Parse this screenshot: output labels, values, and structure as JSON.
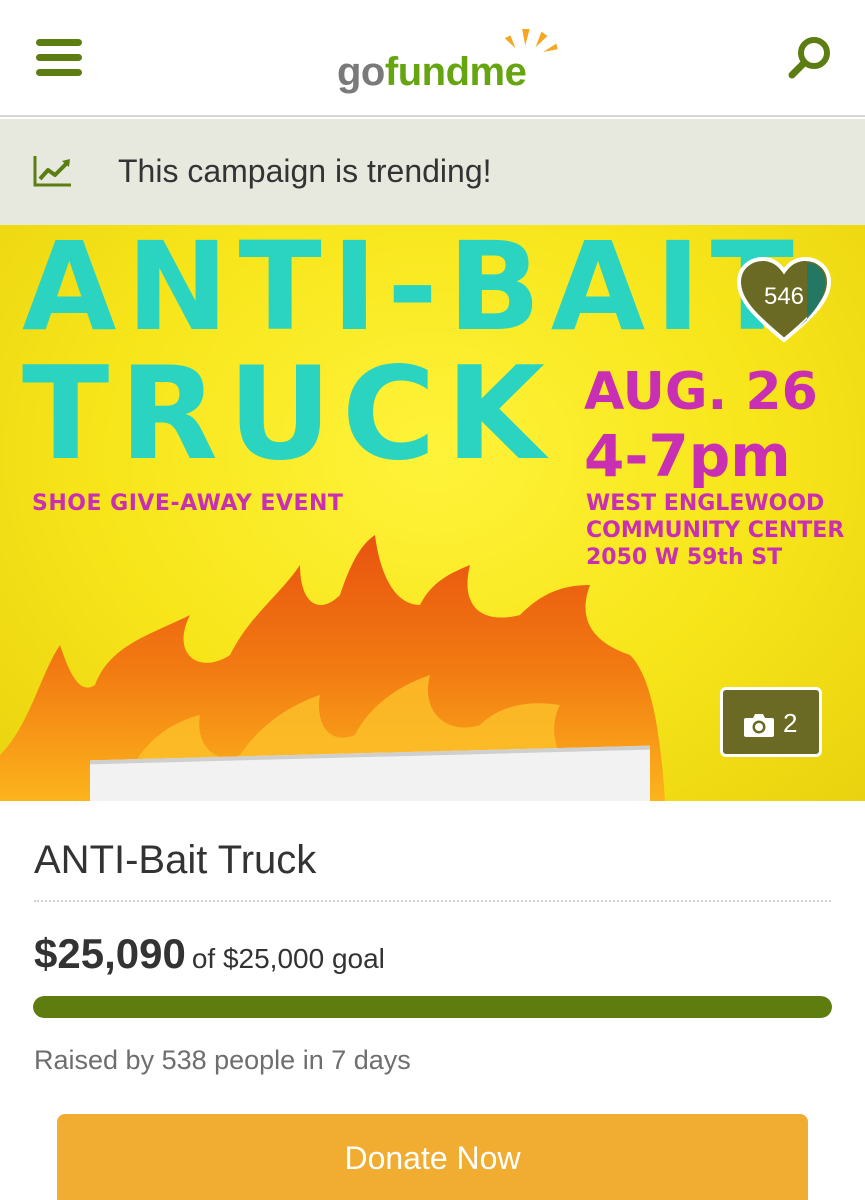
{
  "header": {
    "logo": {
      "go": "go",
      "fund": "fund",
      "me": "me"
    },
    "menu_icon": "hamburger-menu-icon",
    "search_icon": "search-icon"
  },
  "trending": {
    "icon": "trending-chart-icon",
    "text": "This campaign is trending!"
  },
  "hero": {
    "poster": {
      "title_line1": "ANTI-BAIT",
      "title_line2": "TRUCK",
      "subtitle": "SHOE GIVE-AWAY EVENT",
      "date": "AUG. 26",
      "time": "4-7pm",
      "address_line1": "WEST ENGLEWOOD",
      "address_line2": "COMMUNITY CENTER",
      "address_line3": "2050 W 59th ST"
    },
    "hearts": "546",
    "photo_count": "2"
  },
  "campaign": {
    "title": "ANTI-Bait Truck",
    "raised": "$25,090",
    "goal_text": "of $25,000 goal",
    "progress_fraction": 1.0,
    "raised_by": "Raised by 538 people in 7 days",
    "donate_label": "Donate Now"
  },
  "colors": {
    "brand_green": "#5f7d0f",
    "logo_green": "#66a510",
    "donate_orange": "#f0ad32",
    "trending_bg": "#e7e9df",
    "poster_teal": "#2bd4c0",
    "poster_magenta": "#c92fb2",
    "poster_yellow": "#f7e51a"
  }
}
